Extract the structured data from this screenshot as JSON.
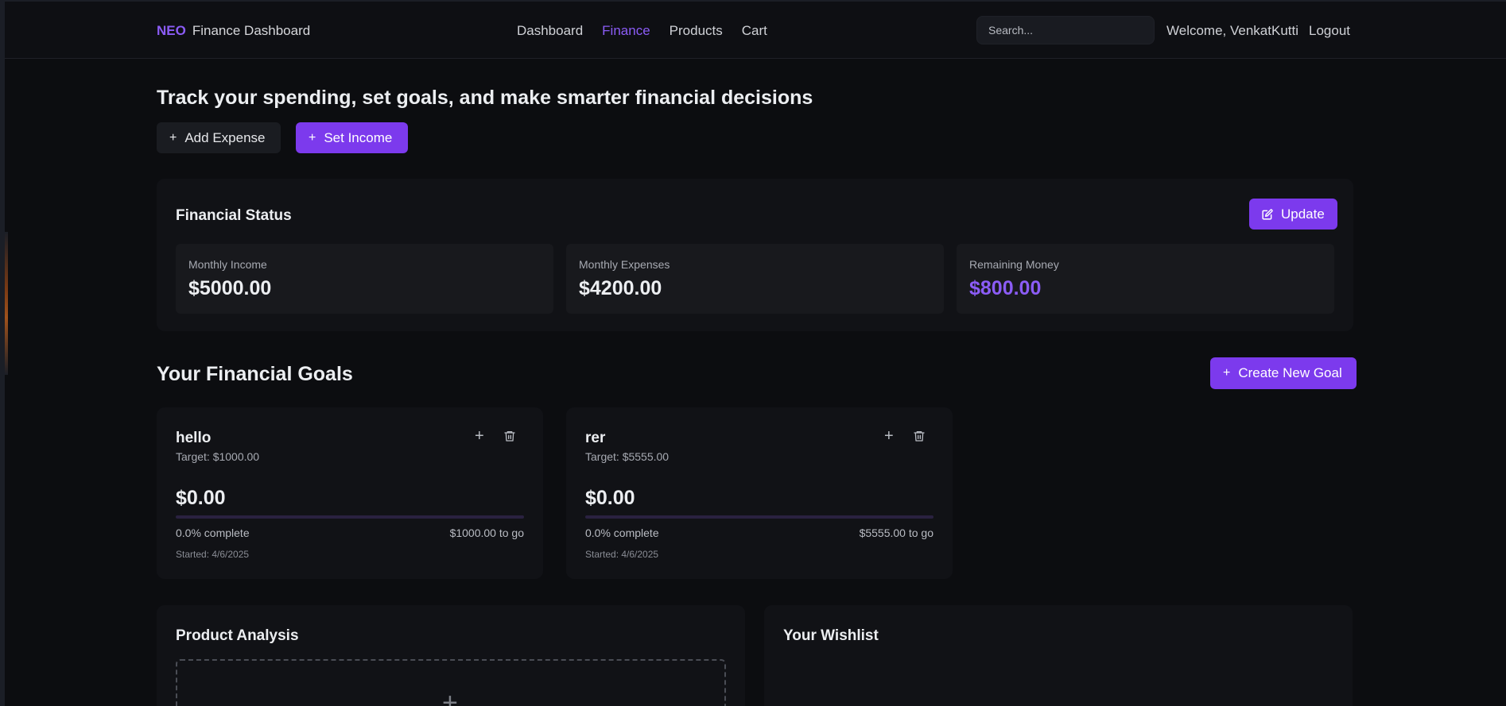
{
  "nav": {
    "brand_short": "NEO",
    "brand_title": "Finance Dashboard",
    "links": [
      "Dashboard",
      "Finance",
      "Products",
      "Cart"
    ],
    "active_link": "Finance",
    "search_placeholder": "Search...",
    "welcome": "Welcome, VenkatKutti",
    "logout": "Logout"
  },
  "header": {
    "tagline": "Track your spending, set goals, and make smarter financial decisions",
    "add_expense": "Add Expense",
    "set_income": "Set Income"
  },
  "status": {
    "title": "Financial Status",
    "update": "Update",
    "cards": [
      {
        "label": "Monthly Income",
        "value": "$5000.00"
      },
      {
        "label": "Monthly Expenses",
        "value": "$4200.00"
      },
      {
        "label": "Remaining Money",
        "value": "$800.00"
      }
    ]
  },
  "goals": {
    "title": "Your Financial Goals",
    "create": "Create New Goal",
    "items": [
      {
        "name": "hello",
        "target": "Target: $1000.00",
        "amount": "$0.00",
        "progress": 0,
        "complete": "0.0% complete",
        "to_go": "$1000.00 to go",
        "started": "Started: 4/6/2025"
      },
      {
        "name": "rer",
        "target": "Target: $5555.00",
        "amount": "$0.00",
        "progress": 0,
        "complete": "0.0% complete",
        "to_go": "$5555.00 to go",
        "started": "Started: 4/6/2025"
      }
    ]
  },
  "panels": {
    "product_analysis": "Product Analysis",
    "wishlist": "Your Wishlist"
  },
  "colors": {
    "accent": "#7c3aed",
    "accent_text": "#8b5cf6",
    "background": "#0c0d10",
    "card": "#111216"
  },
  "icons": {
    "plus": "plus-icon",
    "edit": "edit-icon",
    "trash": "trash-icon"
  }
}
